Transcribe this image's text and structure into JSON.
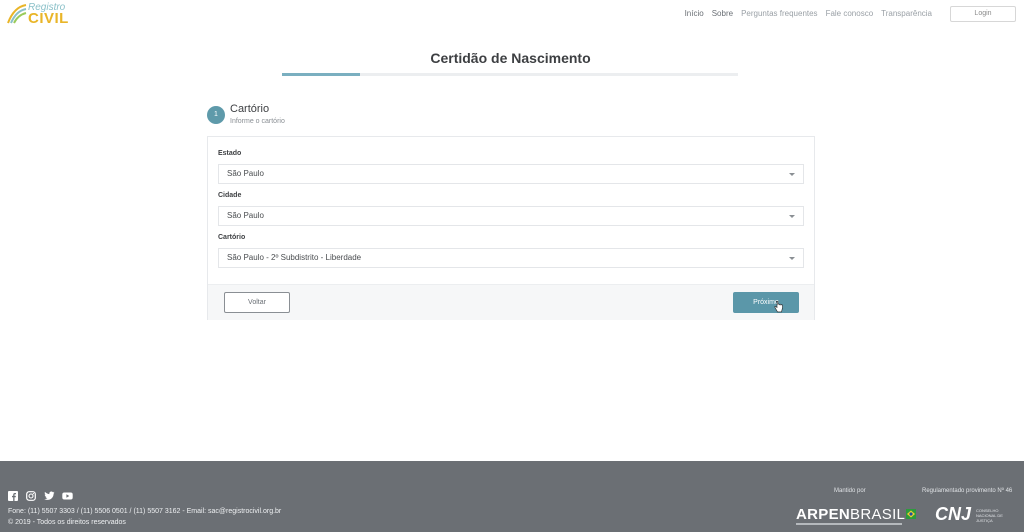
{
  "header": {
    "logo_text_top": "Registro",
    "logo_text_main": "CIVIL",
    "nav": [
      "Início",
      "Sobre",
      "Perguntas frequentes",
      "Fale conosco",
      "Transparência"
    ],
    "login_label": "Login"
  },
  "page": {
    "title": "Certidão de Nascimento",
    "progress_fraction": 0.17
  },
  "step": {
    "number": "1",
    "title": "Cartório",
    "subtitle": "Informe o cartório"
  },
  "form": {
    "estado_label": "Estado",
    "estado_value": "São Paulo",
    "cidade_label": "Cidade",
    "cidade_value": "São Paulo",
    "cartorio_label": "Cartório",
    "cartorio_value": "São Paulo - 2º Subdistrito - Liberdade",
    "back_label": "Voltar",
    "next_label": "Próximo"
  },
  "footer": {
    "contact": "Fone: (11) 5507 3303 / (11) 5506 0501 / (11) 5507 3162 - Email: sac@registrocivil.org.br",
    "copyright": "© 2019 - Todos os direitos reservados",
    "maintained_by_label": "Mantido por",
    "regulation_label": "Regulamentado provimento Nº 46",
    "arpen_text_a": "ARPEN",
    "arpen_text_b": "BRASIL",
    "cnj_text": "CNJ",
    "cnj_sub": "CONSELHO NACIONAL DE JUSTIÇA",
    "social_icons": [
      "facebook-icon",
      "instagram-icon",
      "twitter-icon",
      "youtube-icon"
    ]
  },
  "colors": {
    "accent": "#5b97a9",
    "footer_bg": "#6b6f74",
    "logo_yellow": "#e9b528"
  }
}
